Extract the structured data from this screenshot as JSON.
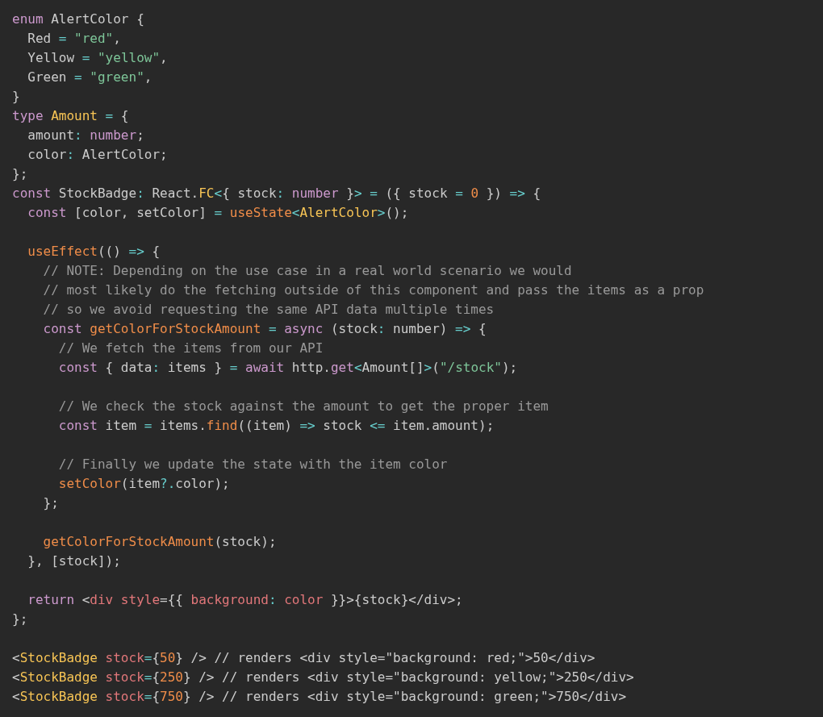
{
  "code_lines": [
    {
      "tokens": [
        {
          "text": "enum",
          "color": "#cc99cd"
        },
        {
          "text": " AlertColor {",
          "color": "#cccccc"
        }
      ]
    },
    {
      "tokens": [
        {
          "text": "  Red ",
          "color": "#cccccc"
        },
        {
          "text": "=",
          "color": "#67cdcc"
        },
        {
          "text": " \"red\"",
          "color": "#7ec699"
        },
        {
          "text": ",",
          "color": "#cccccc"
        }
      ]
    },
    {
      "tokens": [
        {
          "text": "  Yellow ",
          "color": "#cccccc"
        },
        {
          "text": "=",
          "color": "#67cdcc"
        },
        {
          "text": " \"yellow\"",
          "color": "#7ec699"
        },
        {
          "text": ",",
          "color": "#cccccc"
        }
      ]
    },
    {
      "tokens": [
        {
          "text": "  Green ",
          "color": "#cccccc"
        },
        {
          "text": "=",
          "color": "#67cdcc"
        },
        {
          "text": " \"green\"",
          "color": "#7ec699"
        },
        {
          "text": ",",
          "color": "#cccccc"
        }
      ]
    },
    {
      "tokens": [
        {
          "text": "}",
          "color": "#cccccc"
        }
      ]
    },
    {
      "tokens": [
        {
          "text": "type",
          "color": "#cc99cd"
        },
        {
          "text": " Amount",
          "color": "#f8c555"
        },
        {
          "text": " =",
          "color": "#67cdcc"
        },
        {
          "text": " {",
          "color": "#cccccc"
        }
      ]
    },
    {
      "tokens": [
        {
          "text": "  amount",
          "color": "#cccccc"
        },
        {
          "text": ":",
          "color": "#67cdcc"
        },
        {
          "text": " number",
          "color": "#cc99cd"
        },
        {
          "text": ";",
          "color": "#cccccc"
        }
      ]
    },
    {
      "tokens": [
        {
          "text": "  color",
          "color": "#cccccc"
        },
        {
          "text": ":",
          "color": "#67cdcc"
        },
        {
          "text": " AlertColor;",
          "color": "#cccccc"
        }
      ]
    },
    {
      "tokens": [
        {
          "text": "};",
          "color": "#cccccc"
        }
      ]
    },
    {
      "tokens": [
        {
          "text": "const",
          "color": "#cc99cd"
        },
        {
          "text": " StockBadge",
          "color": "#cccccc"
        },
        {
          "text": ":",
          "color": "#67cdcc"
        },
        {
          "text": " React.",
          "color": "#cccccc"
        },
        {
          "text": "FC",
          "color": "#f8c555"
        },
        {
          "text": "<",
          "color": "#67cdcc"
        },
        {
          "text": "{ stock",
          "color": "#cccccc"
        },
        {
          "text": ":",
          "color": "#67cdcc"
        },
        {
          "text": " number",
          "color": "#cc99cd"
        },
        {
          "text": " }",
          "color": "#cccccc"
        },
        {
          "text": ">",
          "color": "#67cdcc"
        },
        {
          "text": " =",
          "color": "#67cdcc"
        },
        {
          "text": " ({ stock ",
          "color": "#cccccc"
        },
        {
          "text": "=",
          "color": "#67cdcc"
        },
        {
          "text": " 0",
          "color": "#f08d49"
        },
        {
          "text": " }) ",
          "color": "#cccccc"
        },
        {
          "text": "=>",
          "color": "#67cdcc"
        },
        {
          "text": " {",
          "color": "#cccccc"
        }
      ]
    },
    {
      "tokens": [
        {
          "text": "  const",
          "color": "#cc99cd"
        },
        {
          "text": " [color, setColor] ",
          "color": "#cccccc"
        },
        {
          "text": "=",
          "color": "#67cdcc"
        },
        {
          "text": " useState",
          "color": "#f08d49"
        },
        {
          "text": "<",
          "color": "#67cdcc"
        },
        {
          "text": "AlertColor",
          "color": "#f8c555"
        },
        {
          "text": ">",
          "color": "#67cdcc"
        },
        {
          "text": "();",
          "color": "#cccccc"
        }
      ]
    },
    {
      "kind": "blank"
    },
    {
      "tokens": [
        {
          "text": "  useEffect",
          "color": "#f08d49"
        },
        {
          "text": "(() ",
          "color": "#cccccc"
        },
        {
          "text": "=>",
          "color": "#67cdcc"
        },
        {
          "text": " {",
          "color": "#cccccc"
        }
      ]
    },
    {
      "tokens": [
        {
          "text": "    // NOTE: Depending on the use case in a real world scenario we would",
          "color": "#999999"
        }
      ]
    },
    {
      "tokens": [
        {
          "text": "    // most likely do the fetching outside of this component and pass the items as a prop",
          "color": "#999999"
        }
      ]
    },
    {
      "tokens": [
        {
          "text": "    // so we avoid requesting the same API data multiple times",
          "color": "#999999"
        }
      ]
    },
    {
      "tokens": [
        {
          "text": "    const",
          "color": "#cc99cd"
        },
        {
          "text": " getColorForStockAmount",
          "color": "#f08d49"
        },
        {
          "text": " =",
          "color": "#67cdcc"
        },
        {
          "text": " async",
          "color": "#cc99cd"
        },
        {
          "text": " (stock",
          "color": "#cccccc"
        },
        {
          "text": ":",
          "color": "#67cdcc"
        },
        {
          "text": " number) ",
          "color": "#cccccc"
        },
        {
          "text": "=>",
          "color": "#67cdcc"
        },
        {
          "text": " {",
          "color": "#cccccc"
        }
      ]
    },
    {
      "tokens": [
        {
          "text": "      // We fetch the items from our API",
          "color": "#999999"
        }
      ]
    },
    {
      "tokens": [
        {
          "text": "      const",
          "color": "#cc99cd"
        },
        {
          "text": " { data",
          "color": "#cccccc"
        },
        {
          "text": ":",
          "color": "#67cdcc"
        },
        {
          "text": " items } ",
          "color": "#cccccc"
        },
        {
          "text": "=",
          "color": "#67cdcc"
        },
        {
          "text": " await",
          "color": "#cc99cd"
        },
        {
          "text": " http.",
          "color": "#cccccc"
        },
        {
          "text": "get",
          "color": "#cc99cd"
        },
        {
          "text": "<",
          "color": "#67cdcc"
        },
        {
          "text": "Amount[]",
          "color": "#cccccc"
        },
        {
          "text": ">",
          "color": "#67cdcc"
        },
        {
          "text": "(",
          "color": "#cccccc"
        },
        {
          "text": "\"/stock\"",
          "color": "#7ec699"
        },
        {
          "text": ");",
          "color": "#cccccc"
        }
      ]
    },
    {
      "kind": "blank"
    },
    {
      "tokens": [
        {
          "text": "      // We check the stock against the amount to get the proper item",
          "color": "#999999"
        }
      ]
    },
    {
      "tokens": [
        {
          "text": "      const",
          "color": "#cc99cd"
        },
        {
          "text": " item ",
          "color": "#cccccc"
        },
        {
          "text": "=",
          "color": "#67cdcc"
        },
        {
          "text": " items.",
          "color": "#cccccc"
        },
        {
          "text": "find",
          "color": "#f08d49"
        },
        {
          "text": "((item) ",
          "color": "#cccccc"
        },
        {
          "text": "=>",
          "color": "#67cdcc"
        },
        {
          "text": " stock ",
          "color": "#cccccc"
        },
        {
          "text": "<=",
          "color": "#67cdcc"
        },
        {
          "text": " item.amount);",
          "color": "#cccccc"
        }
      ]
    },
    {
      "kind": "blank"
    },
    {
      "tokens": [
        {
          "text": "      // Finally we update the state with the item color",
          "color": "#999999"
        }
      ]
    },
    {
      "tokens": [
        {
          "text": "      setColor",
          "color": "#f08d49"
        },
        {
          "text": "(item",
          "color": "#cccccc"
        },
        {
          "text": "?.",
          "color": "#67cdcc"
        },
        {
          "text": "color);",
          "color": "#cccccc"
        }
      ]
    },
    {
      "tokens": [
        {
          "text": "    };",
          "color": "#cccccc"
        }
      ]
    },
    {
      "kind": "blank"
    },
    {
      "tokens": [
        {
          "text": "    getColorForStockAmount",
          "color": "#f08d49"
        },
        {
          "text": "(stock);",
          "color": "#cccccc"
        }
      ]
    },
    {
      "tokens": [
        {
          "text": "  }, [stock]);",
          "color": "#cccccc"
        }
      ]
    },
    {
      "kind": "blank"
    },
    {
      "tokens": [
        {
          "text": "  return",
          "color": "#cc99cd"
        },
        {
          "text": " <",
          "color": "#cccccc"
        },
        {
          "text": "div",
          "color": "#e2777a"
        },
        {
          "text": " style",
          "color": "#e2777a"
        },
        {
          "text": "={{ ",
          "color": "#cccccc"
        },
        {
          "text": "background",
          "color": "#e2777a"
        },
        {
          "text": ":",
          "color": "#67cdcc"
        },
        {
          "text": " color",
          "color": "#e2777a"
        },
        {
          "text": " }}>{stock}</div>;",
          "color": "#cccccc"
        }
      ]
    },
    {
      "tokens": [
        {
          "text": "};",
          "color": "#cccccc"
        }
      ]
    },
    {
      "kind": "blank"
    },
    {
      "tokens": [
        {
          "text": "<",
          "color": "#cccccc"
        },
        {
          "text": "StockBadge",
          "color": "#f8c555"
        },
        {
          "text": " stock",
          "color": "#e2777a"
        },
        {
          "text": "=",
          "color": "#67cdcc"
        },
        {
          "text": "{",
          "color": "#cccccc"
        },
        {
          "text": "50",
          "color": "#f08d49"
        },
        {
          "text": "} /> // renders <div style=\"background: red;\">50</div>",
          "color": "#cccccc"
        }
      ]
    },
    {
      "tokens": [
        {
          "text": "<",
          "color": "#cccccc"
        },
        {
          "text": "StockBadge",
          "color": "#f8c555"
        },
        {
          "text": " stock",
          "color": "#e2777a"
        },
        {
          "text": "=",
          "color": "#67cdcc"
        },
        {
          "text": "{",
          "color": "#cccccc"
        },
        {
          "text": "250",
          "color": "#f08d49"
        },
        {
          "text": "} /> // renders <div style=\"background: yellow;\">250</div>",
          "color": "#cccccc"
        }
      ]
    },
    {
      "tokens": [
        {
          "text": "<",
          "color": "#cccccc"
        },
        {
          "text": "StockBadge",
          "color": "#f8c555"
        },
        {
          "text": " stock",
          "color": "#e2777a"
        },
        {
          "text": "=",
          "color": "#67cdcc"
        },
        {
          "text": "{",
          "color": "#cccccc"
        },
        {
          "text": "750",
          "color": "#f08d49"
        },
        {
          "text": "} /> // renders <div style=\"background: green;\">750</div>",
          "color": "#cccccc"
        }
      ]
    }
  ]
}
